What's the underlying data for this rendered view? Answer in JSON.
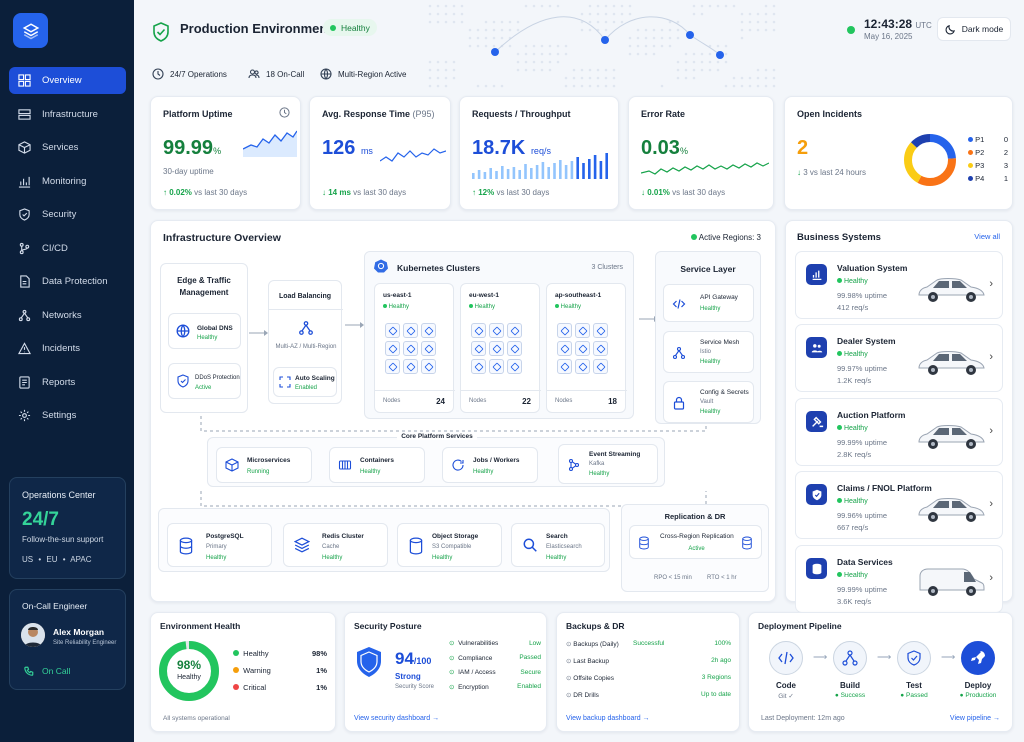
{
  "sidebar": {
    "items": [
      {
        "label": "Overview",
        "icon": "grid-icon",
        "active": true
      },
      {
        "label": "Infrastructure",
        "icon": "server-icon"
      },
      {
        "label": "Services",
        "icon": "cube-icon"
      },
      {
        "label": "Monitoring",
        "icon": "chart-icon"
      },
      {
        "label": "Security",
        "icon": "shield-icon"
      },
      {
        "label": "CI/CD",
        "icon": "branch-icon"
      },
      {
        "label": "Data Protection",
        "icon": "file-shield-icon"
      },
      {
        "label": "Networks",
        "icon": "network-icon"
      },
      {
        "label": "Incidents",
        "icon": "alert-icon"
      },
      {
        "label": "Reports",
        "icon": "report-icon"
      },
      {
        "label": "Settings",
        "icon": "gear-icon"
      }
    ],
    "ops_center": {
      "title": "Operations Center",
      "big": "24/7",
      "sub": "Follow-the-sun support",
      "regions": "US • EU • APAC"
    },
    "oncall": {
      "title": "On-Call Engineer",
      "name": "Alex Morgan",
      "role": "Site Reliability Engineer",
      "action": "On Call"
    }
  },
  "header": {
    "title": "Production Environment",
    "status": "Healthy",
    "strip": [
      "24/7 Operations",
      "18 On-Call",
      "Multi-Region Active"
    ],
    "time": "12:43:28",
    "tz": "UTC",
    "date": "May 16, 2025",
    "dark_mode": "Dark mode"
  },
  "kpis": {
    "uptime": {
      "label": "Platform Uptime",
      "value": "99.99",
      "unit": "%",
      "sub": "30-day uptime",
      "delta": "0.02%",
      "delta_text": "vs last 30 days"
    },
    "response": {
      "label": "Avg. Response Time",
      "label_suffix": "(P95)",
      "value": "126",
      "unit": "ms",
      "delta": "14 ms",
      "delta_text": "vs last 30 days"
    },
    "requests": {
      "label": "Requests / Throughput",
      "value": "18.7K",
      "unit": "req/s",
      "delta": "12%",
      "delta_text": "vs last 30 days"
    },
    "errors": {
      "label": "Error Rate",
      "value": "0.03",
      "unit": "%",
      "delta": "0.01%",
      "delta_text": "vs last 30 days"
    },
    "incidents": {
      "label": "Open Incidents",
      "value": "2",
      "delta": "3",
      "delta_text": "vs last 24 hours",
      "legend": [
        {
          "k": "P1",
          "v": "0",
          "color": "#2563eb"
        },
        {
          "k": "P2",
          "v": "2",
          "color": "#f97316"
        },
        {
          "k": "P3",
          "v": "3",
          "color": "#facc15"
        },
        {
          "k": "P4",
          "v": "1",
          "color": "#1e40af"
        }
      ]
    }
  },
  "infra": {
    "title": "Infrastructure Overview",
    "regions": "Active Regions: 3",
    "edge": {
      "title1": "Edge & Traffic",
      "title2": "Management",
      "dns": "Global DNS",
      "dns_s": "Healthy",
      "ddos": "DDoS Protection",
      "ddos_s": "Active"
    },
    "lb": {
      "title": "Load Balancing",
      "sub": "Multi-AZ / Multi-Region",
      "auto": "Auto Scaling",
      "auto_s": "Enabled"
    },
    "k8s": {
      "title": "Kubernetes Clusters",
      "count": "3 Clusters",
      "clusters": [
        {
          "name": "us-east-1",
          "s": "Healthy",
          "nodes_label": "Nodes",
          "nodes": "24"
        },
        {
          "name": "eu-west-1",
          "s": "Healthy",
          "nodes_label": "Nodes",
          "nodes": "22"
        },
        {
          "name": "ap-southeast-1",
          "s": "Healthy",
          "nodes_label": "Nodes",
          "nodes": "18"
        }
      ]
    },
    "service_layer": {
      "title": "Service Layer",
      "items": [
        {
          "n": "API Gateway",
          "d": "",
          "s": "Healthy"
        },
        {
          "n": "Service Mesh",
          "d": "Istio",
          "s": "Healthy"
        },
        {
          "n": "Config & Secrets",
          "d": "Vault",
          "s": "Healthy"
        }
      ]
    },
    "core": {
      "title": "Core Platform Services",
      "items": [
        {
          "n": "Microservices",
          "d": "",
          "s": "Running"
        },
        {
          "n": "Containers",
          "d": "",
          "s": "Healthy"
        },
        {
          "n": "Jobs / Workers",
          "d": "",
          "s": "Healthy"
        },
        {
          "n": "Event Streaming",
          "d": "Kafka",
          "s": "Healthy"
        }
      ]
    },
    "data": [
      {
        "n": "PostgreSQL",
        "d": "Primary",
        "s": "Healthy"
      },
      {
        "n": "Redis Cluster",
        "d": "Cache",
        "s": "Healthy"
      },
      {
        "n": "Object Storage",
        "d": "S3 Compatible",
        "s": "Healthy"
      },
      {
        "n": "Search",
        "d": "Elasticsearch",
        "s": "Healthy"
      }
    ],
    "dr": {
      "title": "Replication & DR",
      "inner": "Cross-Region Replication",
      "state": "Active",
      "rpo": "RPO < 15 min",
      "rto": "RTO < 1 hr"
    }
  },
  "business": {
    "title": "Business Systems",
    "view_all": "View all",
    "items": [
      {
        "n": "Valuation System",
        "s": "Healthy",
        "u": "99.98% uptime",
        "q": "412 req/s"
      },
      {
        "n": "Dealer System",
        "s": "Healthy",
        "u": "99.97% uptime",
        "q": "1.2K req/s"
      },
      {
        "n": "Auction Platform",
        "s": "Healthy",
        "u": "99.99% uptime",
        "q": "2.8K req/s"
      },
      {
        "n": "Claims / FNOL Platform",
        "s": "Healthy",
        "u": "99.96% uptime",
        "q": "667 req/s"
      },
      {
        "n": "Data Services",
        "s": "Healthy",
        "u": "99.99% uptime",
        "q": "3.6K req/s"
      }
    ]
  },
  "env_health": {
    "title": "Environment Health",
    "pct": "98%",
    "label": "Healthy",
    "rows": [
      {
        "k": "Healthy",
        "v": "98%",
        "color": "#22c55e"
      },
      {
        "k": "Warning",
        "v": "1%",
        "color": "#f59e0b"
      },
      {
        "k": "Critical",
        "v": "1%",
        "color": "#ef4444"
      }
    ],
    "foot": "All systems operational",
    "healthy_fraction": 0.98
  },
  "security": {
    "title": "Security Posture",
    "score": "94",
    "of": "/100",
    "label": "Strong",
    "sub": "Security Score",
    "rows": [
      {
        "k": "Vulnerabilities",
        "v": "Low"
      },
      {
        "k": "Compliance",
        "v": "Passed"
      },
      {
        "k": "IAM / Access",
        "v": "Secure"
      },
      {
        "k": "Encryption",
        "v": "Enabled"
      }
    ],
    "link": "View security dashboard →"
  },
  "backups": {
    "title": "Backups & DR",
    "rows": [
      {
        "k": "Backups (Daily)",
        "m": "Successful",
        "v": "100%"
      },
      {
        "k": "Last Backup",
        "m": "",
        "v": "2h ago"
      },
      {
        "k": "Offsite Copies",
        "m": "",
        "v": "3 Regions"
      },
      {
        "k": "DR Drills",
        "m": "",
        "v": "Up to date"
      }
    ],
    "link": "View backup dashboard →"
  },
  "pipeline": {
    "title": "Deployment Pipeline",
    "steps": [
      {
        "n": "Code",
        "s": "Git ✓"
      },
      {
        "n": "Build",
        "s": "● Success"
      },
      {
        "n": "Test",
        "s": "● Passed"
      },
      {
        "n": "Deploy",
        "s": "● Production"
      }
    ],
    "last": "Last Deployment: 12m ago",
    "link": "View pipeline →"
  }
}
